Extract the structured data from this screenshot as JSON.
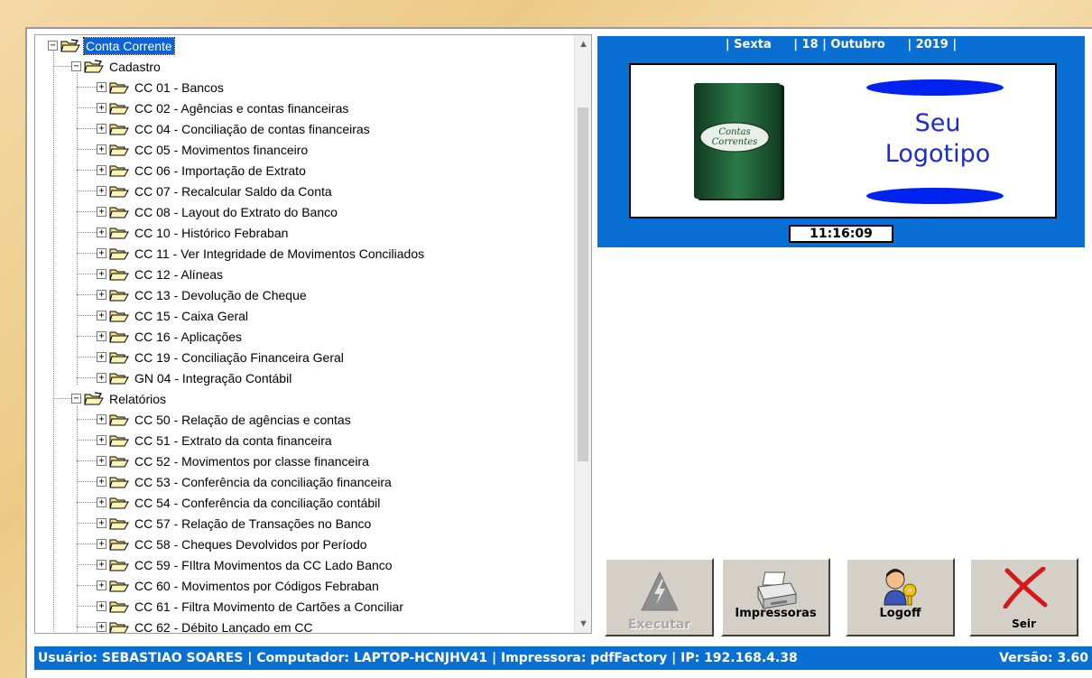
{
  "tree": {
    "root": {
      "label": "Conta Corrente",
      "expander": "−"
    },
    "groups": [
      {
        "label": "Cadastro",
        "items": [
          "CC 01 - Bancos",
          "CC 02 - Agências e contas financeiras",
          "CC 04 - Conciliação de contas financeiras",
          "CC 05 - Movimentos financeiro",
          "CC 06 - Importação de Extrato",
          "CC 07 - Recalcular Saldo da Conta",
          "CC 08 - Layout do Extrato do Banco",
          "CC 10 - Histórico Febraban",
          "CC 11 - Ver Integridade de Movimentos Conciliados",
          "CC 12 - Alíneas",
          "CC 13 - Devolução de Cheque",
          "CC 15 - Caixa Geral",
          "CC 16 - Aplicações",
          "CC 19 - Conciliação Financeira Geral",
          "GN 04 - Integração Contábil"
        ]
      },
      {
        "label": "Relatórios",
        "items": [
          "CC 50 - Relação de agências e contas",
          "CC 51 - Extrato da conta financeira",
          "CC 52 - Movimentos por classe financeira",
          "CC 53 - Conferência da conciliação financeira",
          "CC 54 - Conferência da conciliação contábil",
          "CC 57 - Relação de Transações no Banco",
          "CC 58 - Cheques Devolvidos por Período",
          "CC 59 - FIltra Movimentos da CC Lado Banco",
          "CC 60 - Movimentos por Códigos Febraban",
          "CC 61 - Filtra Movimento de Cartões a Conciliar",
          "CC 62 - Débito Lançado em CC"
        ]
      }
    ],
    "expand_glyph": "+",
    "collapse_glyph": "−"
  },
  "scrollbar": {
    "up_arrow": "▲",
    "down_arrow": "▼"
  },
  "date_bar": {
    "weekday": "| Sexta",
    "day_month": "| 18 | Outubro",
    "year": "| 2019 |"
  },
  "logo": {
    "book_text": "Contas Correntes",
    "line1": "Seu",
    "line2": "Logotipo"
  },
  "clock": "11:16:09",
  "buttons": {
    "execute": {
      "label": "Executar",
      "enabled": false,
      "icon": "lightning-icon"
    },
    "printers": {
      "label": "Impressoras",
      "icon": "printer-icon"
    },
    "logoff": {
      "label": "Logoff",
      "icon": "user-key-icon"
    },
    "exit": {
      "label": "Seir",
      "icon": "red-x-icon"
    }
  },
  "status_bar": {
    "left": "Usuário: SEBASTIAO SOARES | Computador: LAPTOP-HCNJHV41 | Impressora: pdfFactory | IP: 192.168.4.38",
    "right": "Versão: 3.60"
  },
  "colors": {
    "panel_blue": "#0a6fd2",
    "logo_text": "#1a2bd6",
    "ellipse": "#0022ee",
    "selection": "#0a64d6",
    "book_green": "#1f6a3a"
  }
}
